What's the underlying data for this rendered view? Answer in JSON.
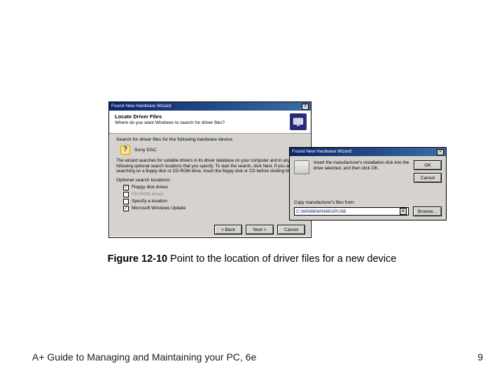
{
  "dlg1": {
    "title": "Found New Hardware Wizard",
    "header_title": "Locate Driver Files",
    "header_sub": "Where do you want Windows to search for driver files?",
    "lead": "Search for driver files for the following hardware device:",
    "device_name": "Sony DSC",
    "para": "The wizard searches for suitable drivers in its driver database on your computer and in any of the following optional search locations that you specify.\nTo start the search, click Next. If you are searching on a floppy disk or CD-ROM drive, insert the floppy disk or CD before clicking Next.",
    "opt_label": "Optional search locations:",
    "opts": [
      {
        "checked": true,
        "disabled": false,
        "label": "Floppy disk drives"
      },
      {
        "checked": false,
        "disabled": true,
        "label": "CD-ROM drives"
      },
      {
        "checked": false,
        "disabled": false,
        "label": "Specify a location"
      },
      {
        "checked": true,
        "disabled": false,
        "label": "Microsoft Windows Update"
      }
    ],
    "buttons": {
      "back": "< Back",
      "next": "Next >",
      "cancel": "Cancel"
    }
  },
  "dlg2": {
    "title": "Found New Hardware Wizard",
    "msg": "Insert the manufacturer's installation disk into the drive selected, and then click OK.",
    "ok": "OK",
    "cancel": "Cancel",
    "copy_label": "Copy manufacturer's files from:",
    "path": "C:\\WIN98\\WIN98\\SPUSB",
    "browse": "Browse..."
  },
  "caption_num": "Figure 12-10",
  "caption_text": " Point to the location of driver files for a new device",
  "footer_left": "A+ Guide to Managing and Maintaining your PC, 6e",
  "footer_right": "9"
}
